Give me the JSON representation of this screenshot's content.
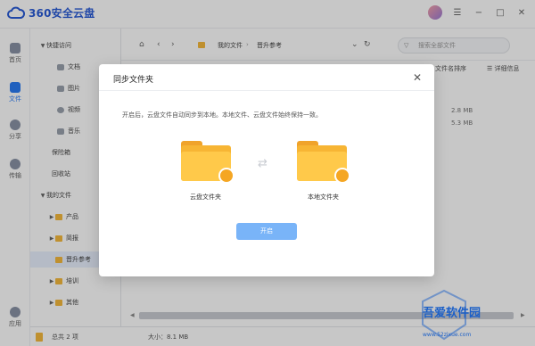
{
  "app": {
    "title": "360安全云盘"
  },
  "left_nav": [
    {
      "label": "首页",
      "icon": "home-icon"
    },
    {
      "label": "文件",
      "icon": "folder-icon",
      "active": true
    },
    {
      "label": "分享",
      "icon": "share-icon"
    },
    {
      "label": "传输",
      "icon": "transfer-icon"
    },
    {
      "label": "应用",
      "icon": "apps-icon"
    }
  ],
  "sidebar": {
    "quick_access": "快捷访问",
    "quick_items": [
      "文档",
      "图片",
      "视频",
      "音乐"
    ],
    "vault": "保险箱",
    "recycle": "回收站",
    "my_files": "我的文件",
    "folders": [
      "产品",
      "简报",
      "晋升参考",
      "培训",
      "其他"
    ],
    "active_folder": "晋升参考"
  },
  "path": {
    "crumbs": [
      "我的文件",
      "晋升参考"
    ]
  },
  "search": {
    "placeholder": "搜索全部文件"
  },
  "toolbar": {
    "sort_label": "文件名排序",
    "details_label": "详细信息"
  },
  "file_sizes": [
    "2.8 MB",
    "5.3 MB"
  ],
  "status": {
    "count": "总共 2 项",
    "size": "大小：8.1 MB"
  },
  "dialog": {
    "title": "同步文件夹",
    "description": "开启后，云盘文件自动同步到本地。本地文件、云盘文件始终保持一致。",
    "cloud_label": "云盘文件夹",
    "local_label": "本地文件夹",
    "button": "开启"
  },
  "watermark": {
    "brand": "吾爱软件园",
    "url": "www.52zixue.com"
  },
  "colors": {
    "accent": "#2a7bf4",
    "folder": "#f7b534",
    "button": "#79b4f8"
  }
}
